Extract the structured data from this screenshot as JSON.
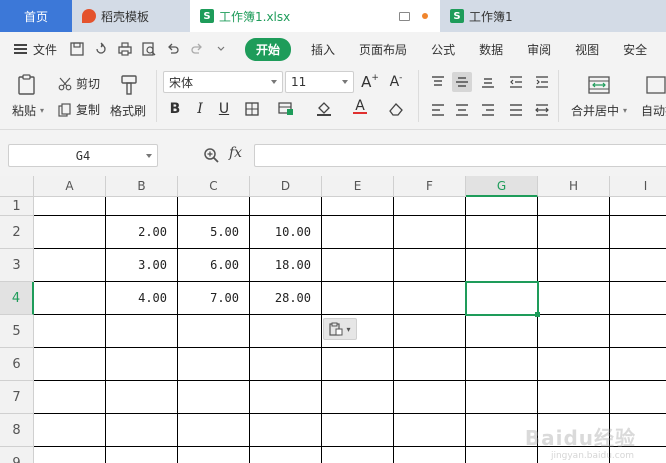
{
  "tabs": {
    "home": "首页",
    "docer": "稻壳模板",
    "workbook_active": "工作簿1.xlsx",
    "workbook_other": "工作簿1"
  },
  "menu": {
    "file": "文件",
    "items": [
      "开始",
      "插入",
      "页面布局",
      "公式",
      "数据",
      "审阅",
      "视图",
      "安全"
    ]
  },
  "ribbon": {
    "paste": "粘贴",
    "cut": "剪切",
    "copy": "复制",
    "format_painter": "格式刷",
    "font_name": "宋体",
    "font_size": "11",
    "grow_font": "A",
    "shrink_font": "A",
    "bold": "B",
    "italic": "I",
    "underline": "U",
    "merge_center": "合并居中",
    "auto_wrap": "自动换"
  },
  "formula_bar": {
    "name_box": "G4",
    "fx": "fx",
    "formula": ""
  },
  "sheet": {
    "columns": [
      "A",
      "B",
      "C",
      "D",
      "E",
      "F",
      "G",
      "H",
      "I"
    ],
    "rows": [
      "1",
      "2",
      "3",
      "4",
      "5",
      "6",
      "7",
      "8",
      "9"
    ],
    "selected_cell": "G4",
    "cells": {
      "B2": "2.00",
      "C2": "5.00",
      "D2": "10.00",
      "B3": "3.00",
      "C3": "6.00",
      "D3": "18.00",
      "B4": "4.00",
      "C4": "7.00",
      "D4": "28.00"
    }
  },
  "watermark": {
    "main": "Baidu经验",
    "sub": "jingyan.baidu.com"
  },
  "colors": {
    "accent_green": "#1e9c5a",
    "home_tab_blue": "#3c78d8",
    "font_color_red": "#e0302f"
  }
}
